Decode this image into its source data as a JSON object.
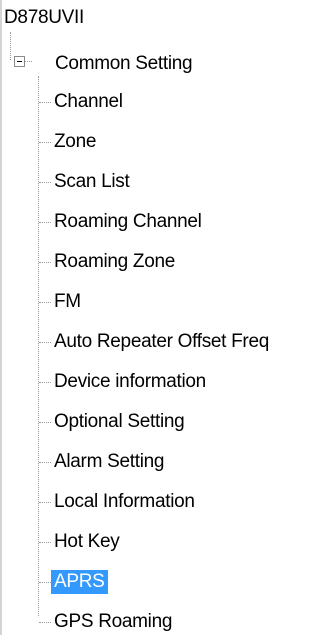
{
  "tree": {
    "root": "D878UVII",
    "common": {
      "label": "Common Setting",
      "expander_icon": "minus-box-icon",
      "expanded": true
    },
    "items": [
      {
        "label": "Channel",
        "selected": false
      },
      {
        "label": "Zone",
        "selected": false
      },
      {
        "label": "Scan List",
        "selected": false
      },
      {
        "label": "Roaming Channel",
        "selected": false
      },
      {
        "label": "Roaming Zone",
        "selected": false
      },
      {
        "label": "FM",
        "selected": false
      },
      {
        "label": "Auto Repeater Offset Freq",
        "selected": false
      },
      {
        "label": "Device information",
        "selected": false
      },
      {
        "label": "Optional Setting",
        "selected": false
      },
      {
        "label": "Alarm Setting",
        "selected": false
      },
      {
        "label": "Local Information",
        "selected": false
      },
      {
        "label": "Hot Key",
        "selected": false
      },
      {
        "label": "APRS",
        "selected": true
      },
      {
        "label": "GPS Roaming",
        "selected": false
      }
    ],
    "selection_color": "#3399ff"
  }
}
